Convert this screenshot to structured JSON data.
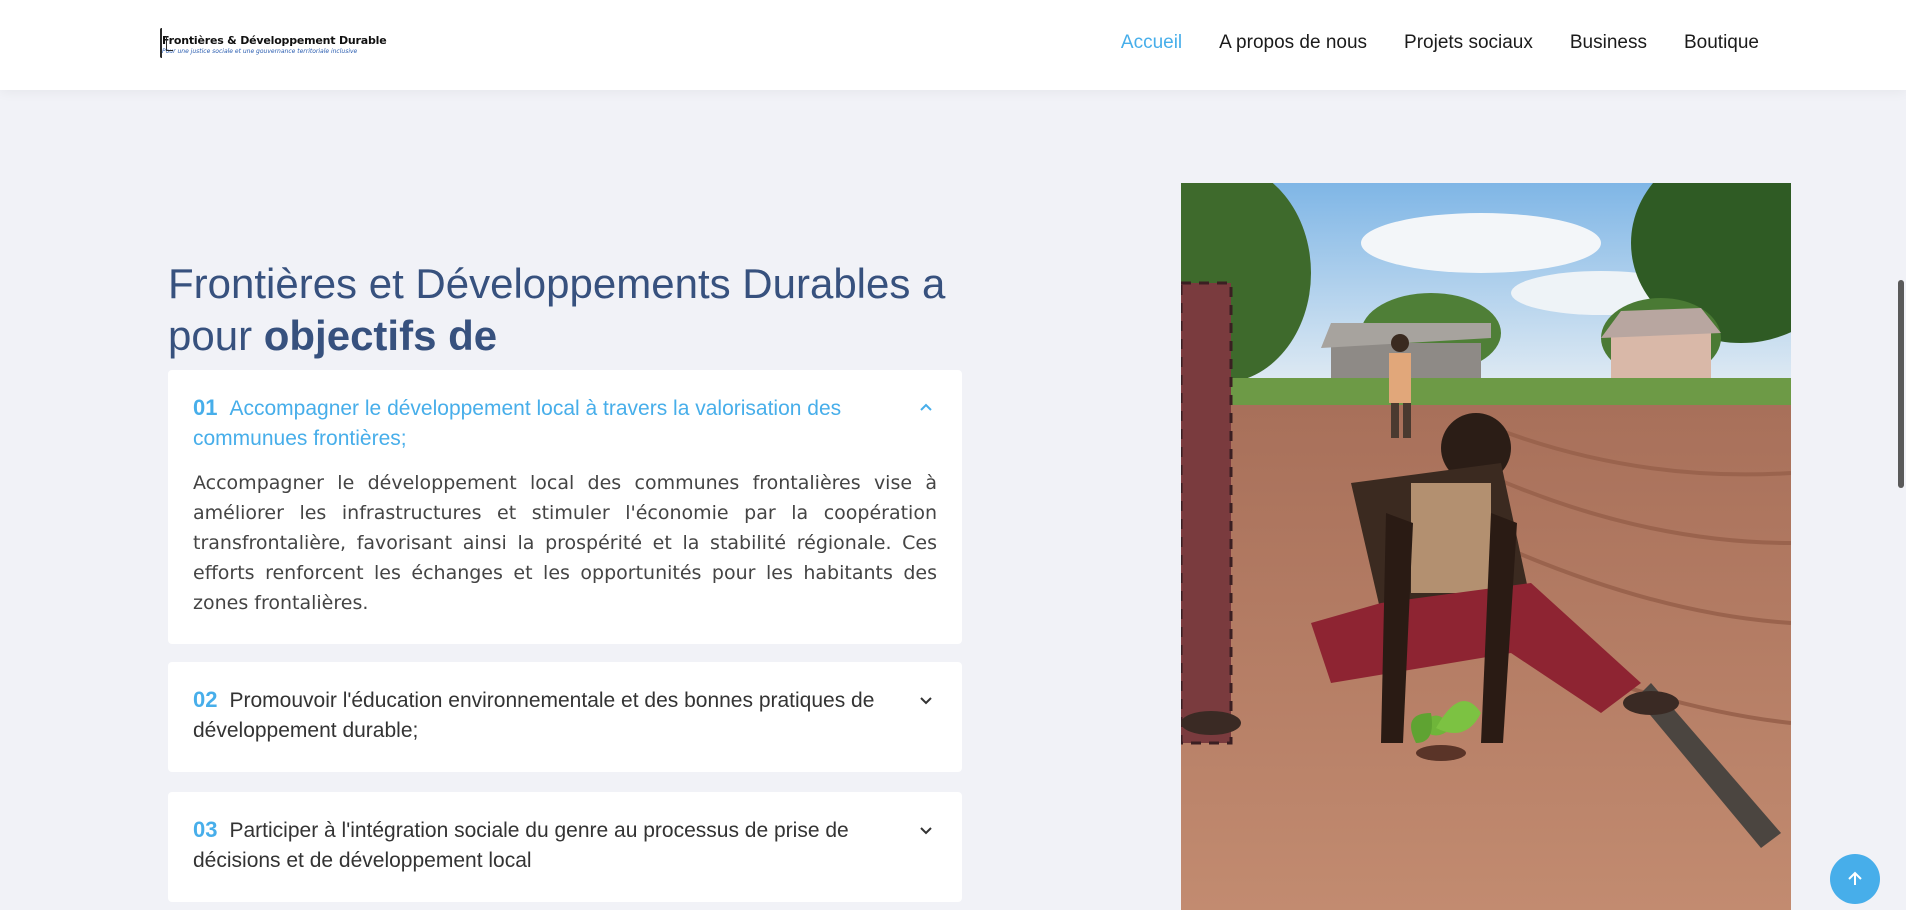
{
  "header": {
    "logo": {
      "title": "Frontières & Développement Durable",
      "tagline": "Pour une justice sociale et une gouvernance territoriale inclusive"
    },
    "nav": [
      {
        "label": "Accueil",
        "active": true
      },
      {
        "label": "A propos de nous",
        "active": false
      },
      {
        "label": "Projets sociaux",
        "active": false
      },
      {
        "label": "Business",
        "active": false
      },
      {
        "label": "Boutique",
        "active": false
      }
    ]
  },
  "section": {
    "heading_text": "Frontières et Développements Durables a pour",
    "heading_strong": "objectifs de",
    "items": [
      {
        "num": "01",
        "title": "Accompagner le développement local à travers la valorisation des communues frontières;",
        "expanded": true,
        "body": "Accompagner le développement local des communes frontalières vise à améliorer les infrastructures et stimuler l'économie par la coopération transfrontalière, favorisant ainsi la prospérité et la stabilité régionale. Ces efforts renforcent les échanges et les opportunités pour les habitants des zones frontalières."
      },
      {
        "num": "02",
        "title": "Promouvoir l'éducation environnementale et des bonnes pratiques de développement durable;",
        "expanded": false
      },
      {
        "num": "03",
        "title": "Participer à l'intégration sociale du genre au processus de prise de décisions et de développement local",
        "expanded": false
      }
    ]
  },
  "colors": {
    "accent": "#47aeea",
    "heading": "#37517e",
    "background": "#f1f2f7"
  },
  "icons": {
    "chevron_open": "chevron-up-icon",
    "chevron_closed": "chevron-down-icon",
    "back_to_top": "arrow-up-icon"
  }
}
